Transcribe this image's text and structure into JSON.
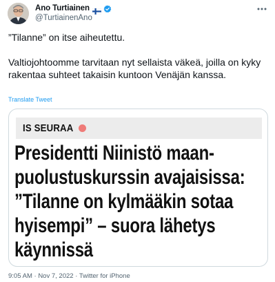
{
  "author": {
    "display_name": "Ano Turtiainen",
    "handle": "@TurtiainenAno",
    "flag_icon": "finland-flag-icon",
    "verified_icon": "verified-badge-icon",
    "verified_color": "#1d9bf0"
  },
  "tweet": {
    "paragraph_1": "”Tilanne” on itse aiheutettu.",
    "paragraph_2": "Valtiojohtoomme tarvitaan nyt sellaista väkeä, joilla on kyky rakentaa suhteet takaisin kuntoon Venäjän kanssa.",
    "translate_label": "Translate Tweet",
    "translate_color": "#1d9bf0"
  },
  "card": {
    "source": "IS SEURAA",
    "live_dot_color": "#ef7b78",
    "headline_lines": [
      "Presidentti Niinistö maan-",
      "puolustuskurssin avajaisissa:",
      "”Tilanne on kylmääkin sotaa",
      "hyisempi” – suora lähetys",
      "käynnissä"
    ]
  },
  "meta": {
    "time": "9:05 AM",
    "separator": "·",
    "date": "Nov 7, 2022",
    "client": "Twitter for iPhone"
  },
  "more_icon": "more-horizontal-icon"
}
